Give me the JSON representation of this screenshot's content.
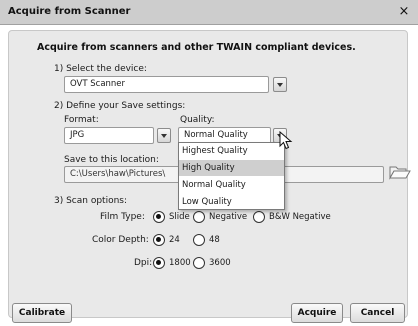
{
  "window": {
    "title": "Acquire from Scanner",
    "close_glyph": "×"
  },
  "heading": "Acquire from scanners and other TWAIN compliant devices.",
  "device": {
    "label": "1) Select the device:",
    "value": "OVT Scanner"
  },
  "save_settings": {
    "label": "2) Define your Save settings:",
    "format_label": "Format:",
    "format_value": "JPG",
    "quality_label": "Quality:",
    "quality_value": "Normal Quality",
    "quality_options": [
      "Highest Quality",
      "High Quality",
      "Normal Quality",
      "Low Quality"
    ],
    "quality_highlighted": "High Quality",
    "location_label": "Save to this location:",
    "location_value": "C:\\Users\\haw\\Pictures\\"
  },
  "scan_options": {
    "label": "3) Scan options:",
    "film_type": {
      "label": "Film Type:",
      "options": [
        "Slide",
        "Negative",
        "B&W Negative"
      ],
      "selected": "Slide"
    },
    "color_depth": {
      "label": "Color Depth:",
      "options": [
        "24",
        "48"
      ],
      "selected": "24"
    },
    "dpi": {
      "label": "Dpi:",
      "options": [
        "1800",
        "3600"
      ],
      "selected": "1800"
    }
  },
  "buttons": {
    "calibrate": "Calibrate",
    "acquire": "Acquire",
    "cancel": "Cancel"
  },
  "icons": {
    "folder": "folder-open-icon",
    "dropdown": "chevron-down-icon",
    "cursor": "mouse-pointer-icon"
  },
  "colors": {
    "titlebar": "#cdcdcd",
    "panel": "#e9e9e9",
    "highlight": "#cfcfcf"
  }
}
